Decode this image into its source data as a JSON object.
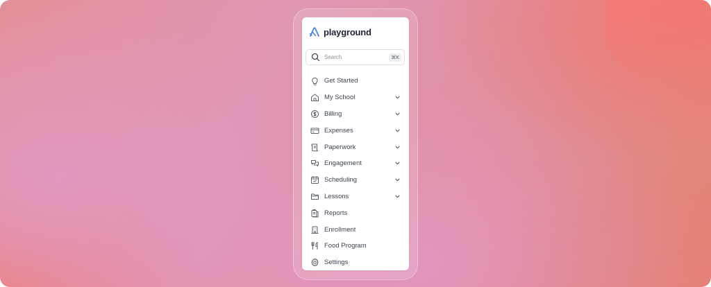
{
  "brand": {
    "name": "playground",
    "logo_icon": "playground-logo-icon",
    "accent_color": "#4d7fd6"
  },
  "search": {
    "placeholder": "Search",
    "shortcut": "⌘K",
    "icon": "search-icon"
  },
  "nav": {
    "items": [
      {
        "label": "Get Started",
        "icon": "lightbulb-icon",
        "has_chevron": false
      },
      {
        "label": "My School",
        "icon": "home-icon",
        "has_chevron": true
      },
      {
        "label": "Billing",
        "icon": "dollar-circle-icon",
        "has_chevron": true
      },
      {
        "label": "Expenses",
        "icon": "credit-card-icon",
        "has_chevron": true
      },
      {
        "label": "Paperwork",
        "icon": "scroll-icon",
        "has_chevron": true
      },
      {
        "label": "Engagement",
        "icon": "chat-bubbles-icon",
        "has_chevron": true
      },
      {
        "label": "Scheduling",
        "icon": "calendar-check-icon",
        "has_chevron": true
      },
      {
        "label": "Lessons",
        "icon": "folder-icon",
        "has_chevron": true
      },
      {
        "label": "Reports",
        "icon": "clipboard-icon",
        "has_chevron": false
      },
      {
        "label": "Enrollment",
        "icon": "building-icon",
        "has_chevron": false
      },
      {
        "label": "Food Program",
        "icon": "utensils-icon",
        "has_chevron": false
      },
      {
        "label": "Settings",
        "icon": "gear-icon",
        "has_chevron": false
      }
    ]
  },
  "colors": {
    "text": "#3d4452",
    "icon": "#5a606b",
    "panel_bg": "#ffffff"
  }
}
